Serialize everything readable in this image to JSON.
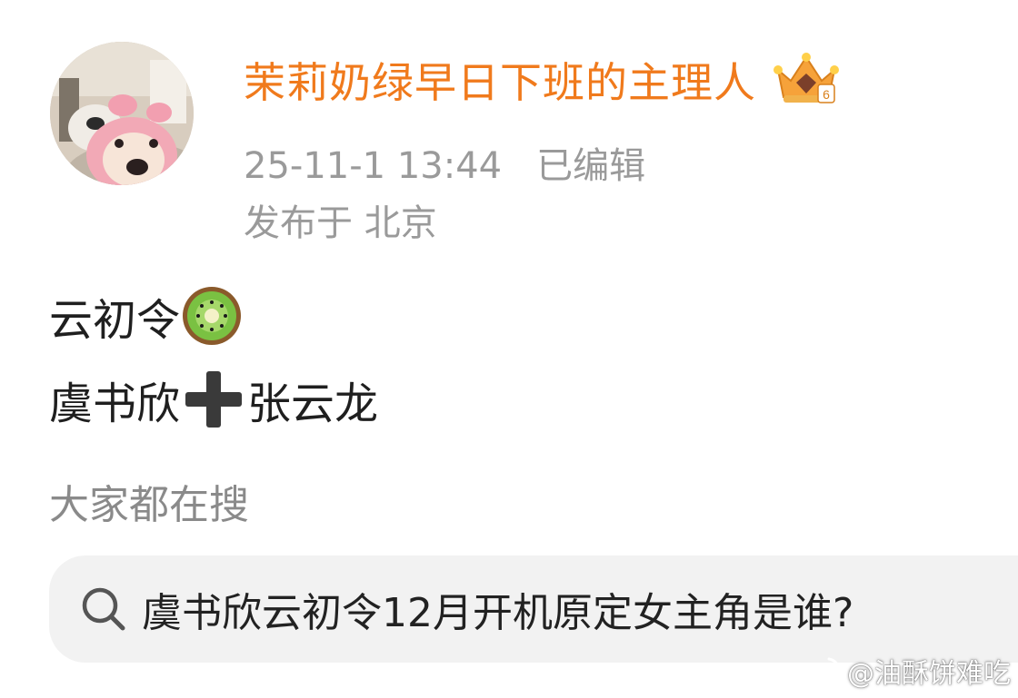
{
  "post": {
    "author": {
      "name": "茉莉奶绿早日下班的主理人",
      "badge_icon": "vip-crown-badge-icon",
      "badge_level": "6"
    },
    "timestamp": "25-11-1 13:44",
    "edited_label": "已编辑",
    "location": "发布于 北京",
    "body": {
      "line1_text": "云初令",
      "line1_emoji": "kiwi-emoji-icon",
      "line2_name_a": "虞书欣",
      "line2_emoji": "plus-emoji-icon",
      "line2_name_b": "张云龙"
    }
  },
  "search": {
    "section_title": "大家都在搜",
    "query": "虞书欣云初令12月开机原定女主角是谁?"
  },
  "watermark": {
    "text": "@油酥饼难吃",
    "logo_icon": "weibo-logo-icon"
  },
  "colors": {
    "username": "#f07a1c",
    "meta_text": "#9a9a9a",
    "body_text": "#1f1f1f",
    "search_bg": "#f2f2f2"
  }
}
